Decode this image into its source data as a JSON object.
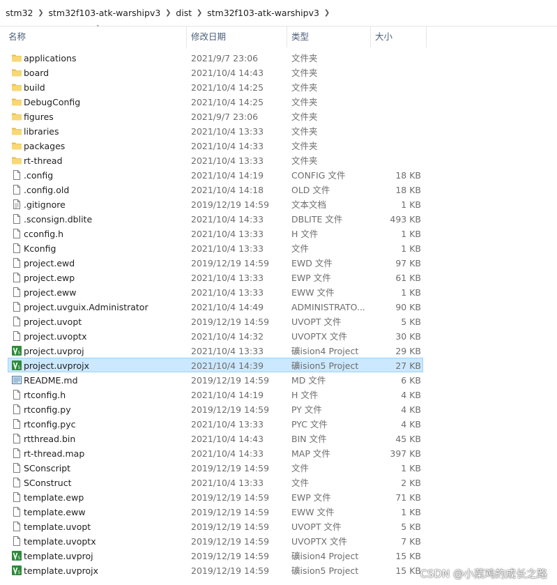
{
  "breadcrumb": [
    "stm32",
    "stm32f103-atk-warshipv3",
    "dist",
    "stm32f103-atk-warshipv3"
  ],
  "columns": {
    "name": "名称",
    "date": "修改日期",
    "type": "类型",
    "size": "大小"
  },
  "colors": {
    "folder": "#f8d775",
    "selection_bg": "#cce8ff",
    "selection_border": "#99d1ff",
    "keil_green": "#2e8b3a"
  },
  "files": [
    {
      "name": "applications",
      "date": "2021/9/7 23:06",
      "type": "文件夹",
      "size": "",
      "icon": "folder-icon"
    },
    {
      "name": "board",
      "date": "2021/10/4 14:43",
      "type": "文件夹",
      "size": "",
      "icon": "folder-icon"
    },
    {
      "name": "build",
      "date": "2021/10/4 14:25",
      "type": "文件夹",
      "size": "",
      "icon": "folder-icon"
    },
    {
      "name": "DebugConfig",
      "date": "2021/10/4 14:25",
      "type": "文件夹",
      "size": "",
      "icon": "folder-icon"
    },
    {
      "name": "figures",
      "date": "2021/9/7 23:06",
      "type": "文件夹",
      "size": "",
      "icon": "folder-icon"
    },
    {
      "name": "libraries",
      "date": "2021/10/4 13:33",
      "type": "文件夹",
      "size": "",
      "icon": "folder-icon"
    },
    {
      "name": "packages",
      "date": "2021/10/4 14:33",
      "type": "文件夹",
      "size": "",
      "icon": "folder-icon"
    },
    {
      "name": "rt-thread",
      "date": "2021/10/4 13:33",
      "type": "文件夹",
      "size": "",
      "icon": "folder-icon"
    },
    {
      "name": ".config",
      "date": "2021/10/4 14:19",
      "type": "CONFIG 文件",
      "size": "18 KB",
      "icon": "file-icon"
    },
    {
      "name": ".config.old",
      "date": "2021/10/4 14:18",
      "type": "OLD 文件",
      "size": "18 KB",
      "icon": "file-icon"
    },
    {
      "name": ".gitignore",
      "date": "2019/12/19 14:59",
      "type": "文本文档",
      "size": "1 KB",
      "icon": "text-file-icon"
    },
    {
      "name": ".sconsign.dblite",
      "date": "2021/10/4 14:33",
      "type": "DBLITE 文件",
      "size": "493 KB",
      "icon": "file-icon"
    },
    {
      "name": "cconfig.h",
      "date": "2021/10/4 13:33",
      "type": "H 文件",
      "size": "1 KB",
      "icon": "file-icon"
    },
    {
      "name": "Kconfig",
      "date": "2021/10/4 13:33",
      "type": "文件",
      "size": "1 KB",
      "icon": "file-icon"
    },
    {
      "name": "project.ewd",
      "date": "2019/12/19 14:59",
      "type": "EWD 文件",
      "size": "97 KB",
      "icon": "file-icon"
    },
    {
      "name": "project.ewp",
      "date": "2021/10/4 13:33",
      "type": "EWP 文件",
      "size": "61 KB",
      "icon": "file-icon"
    },
    {
      "name": "project.eww",
      "date": "2021/10/4 13:33",
      "type": "EWW 文件",
      "size": "1 KB",
      "icon": "file-icon"
    },
    {
      "name": "project.uvguix.Administrator",
      "date": "2021/10/4 14:49",
      "type": "ADMINISTRATO...",
      "size": "90 KB",
      "icon": "file-icon"
    },
    {
      "name": "project.uvopt",
      "date": "2019/12/19 14:59",
      "type": "UVOPT 文件",
      "size": "5 KB",
      "icon": "file-icon"
    },
    {
      "name": "project.uvoptx",
      "date": "2021/10/4 14:32",
      "type": "UVOPTX 文件",
      "size": "30 KB",
      "icon": "file-icon"
    },
    {
      "name": "project.uvproj",
      "date": "2021/10/4 13:33",
      "type": "礦ision4 Project",
      "size": "29 KB",
      "icon": "keil-project-icon"
    },
    {
      "name": "project.uvprojx",
      "date": "2021/10/4 14:39",
      "type": "礦ision5 Project",
      "size": "27 KB",
      "icon": "keil-project-icon",
      "selected": true
    },
    {
      "name": "README.md",
      "date": "2019/12/19 14:59",
      "type": "MD 文件",
      "size": "6 KB",
      "icon": "markdown-file-icon"
    },
    {
      "name": "rtconfig.h",
      "date": "2021/10/4 14:19",
      "type": "H 文件",
      "size": "4 KB",
      "icon": "file-icon"
    },
    {
      "name": "rtconfig.py",
      "date": "2019/12/19 14:59",
      "type": "PY 文件",
      "size": "4 KB",
      "icon": "file-icon"
    },
    {
      "name": "rtconfig.pyc",
      "date": "2021/10/4 13:33",
      "type": "PYC 文件",
      "size": "4 KB",
      "icon": "file-icon"
    },
    {
      "name": "rtthread.bin",
      "date": "2021/10/4 14:43",
      "type": "BIN 文件",
      "size": "45 KB",
      "icon": "file-icon"
    },
    {
      "name": "rt-thread.map",
      "date": "2021/10/4 14:33",
      "type": "MAP 文件",
      "size": "397 KB",
      "icon": "file-icon"
    },
    {
      "name": "SConscript",
      "date": "2019/12/19 14:59",
      "type": "文件",
      "size": "1 KB",
      "icon": "file-icon"
    },
    {
      "name": "SConstruct",
      "date": "2021/10/4 13:33",
      "type": "文件",
      "size": "2 KB",
      "icon": "file-icon"
    },
    {
      "name": "template.ewp",
      "date": "2019/12/19 14:59",
      "type": "EWP 文件",
      "size": "71 KB",
      "icon": "file-icon"
    },
    {
      "name": "template.eww",
      "date": "2019/12/19 14:59",
      "type": "EWW 文件",
      "size": "1 KB",
      "icon": "file-icon"
    },
    {
      "name": "template.uvopt",
      "date": "2019/12/19 14:59",
      "type": "UVOPT 文件",
      "size": "5 KB",
      "icon": "file-icon"
    },
    {
      "name": "template.uvoptx",
      "date": "2019/12/19 14:59",
      "type": "UVOPTX 文件",
      "size": "7 KB",
      "icon": "file-icon"
    },
    {
      "name": "template.uvproj",
      "date": "2019/12/19 14:59",
      "type": "礦ision4 Project",
      "size": "15 KB",
      "icon": "keil-project-icon"
    },
    {
      "name": "template.uvprojx",
      "date": "2019/12/19 14:59",
      "type": "礦ision5 Project",
      "size": "15 KB",
      "icon": "keil-project-icon"
    }
  ],
  "watermark": "CSDN @小菜鸡的成长之路"
}
